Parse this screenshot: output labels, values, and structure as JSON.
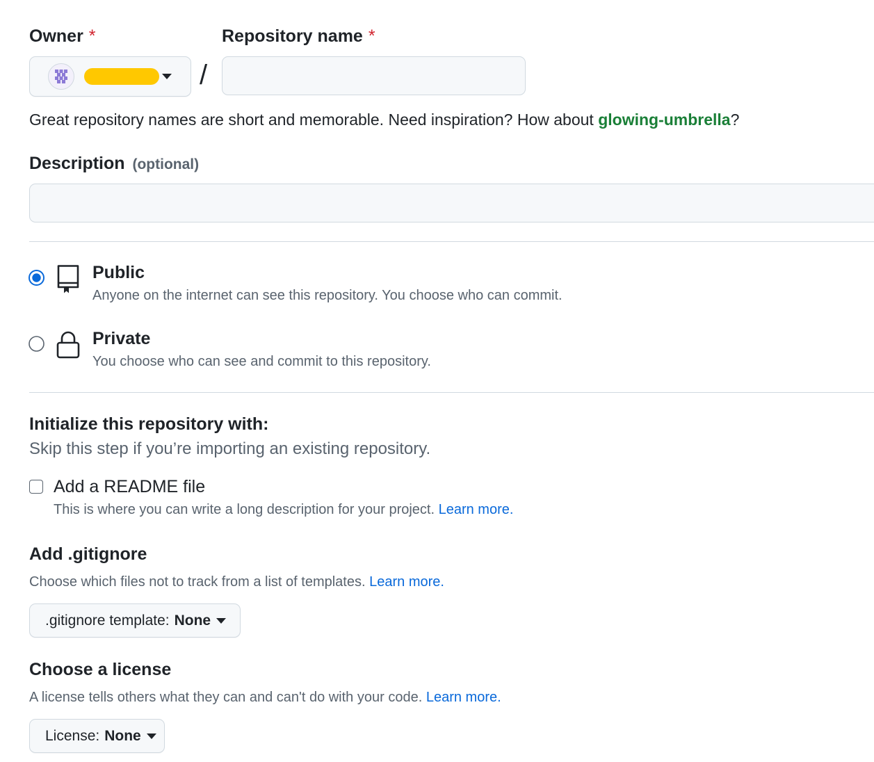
{
  "owner": {
    "label": "Owner",
    "required_mark": "*"
  },
  "repo": {
    "label": "Repository name",
    "required_mark": "*",
    "separator": "/",
    "value": "",
    "hint_prefix": "Great repository names are short and memorable. Need inspiration? How about ",
    "suggestion": "glowing-umbrella",
    "hint_suffix": "?"
  },
  "description": {
    "label": "Description",
    "optional": "(optional)",
    "value": ""
  },
  "visibility": {
    "public": {
      "title": "Public",
      "desc": "Anyone on the internet can see this repository. You choose who can commit.",
      "selected": true
    },
    "private": {
      "title": "Private",
      "desc": "You choose who can see and commit to this repository.",
      "selected": false
    }
  },
  "init": {
    "title": "Initialize this repository with:",
    "subtitle": "Skip this step if you’re importing an existing repository.",
    "readme": {
      "label": "Add a README file",
      "desc": "This is where you can write a long description for your project.",
      "link": "Learn more.",
      "checked": false
    }
  },
  "gitignore": {
    "title": "Add .gitignore",
    "desc": "Choose which files not to track from a list of templates.",
    "link": "Learn more.",
    "button_prefix": ".gitignore template:",
    "button_value": "None"
  },
  "license": {
    "title": "Choose a license",
    "desc": "A license tells others what they can and can't do with your code.",
    "link": "Learn more.",
    "button_prefix": "License:",
    "button_value": "None"
  },
  "colors": {
    "accent": "#0969da",
    "suggestion": "#1a7f37",
    "required": "#d1242f",
    "redaction": "#ffc800"
  },
  "icons": {
    "public": "repo-icon",
    "private": "lock-icon",
    "dropdown": "triangle-down-icon"
  }
}
